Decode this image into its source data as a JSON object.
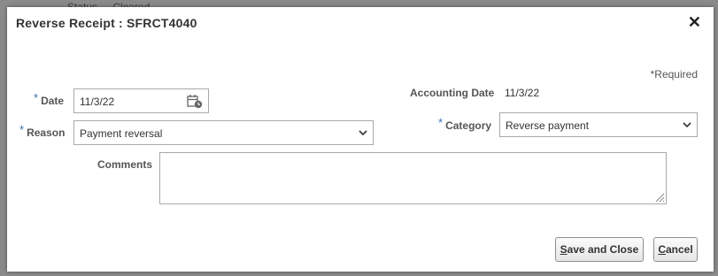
{
  "background": {
    "status_label": "Status",
    "status_value": "Cleared"
  },
  "dialog": {
    "title": "Reverse Receipt : SFRCT4040",
    "close_glyph": "✕",
    "required_note": "*Required"
  },
  "form": {
    "date": {
      "label": "Date",
      "required": "*",
      "value": "11/3/22",
      "icon": "calendar-icon"
    },
    "reason": {
      "label": "Reason",
      "required": "*",
      "value": "Payment reversal"
    },
    "comments": {
      "label": "Comments",
      "value": ""
    },
    "accounting_date": {
      "label": "Accounting Date",
      "value": "11/3/22"
    },
    "category": {
      "label": "Category",
      "required": "*",
      "value": "Reverse payment"
    }
  },
  "buttons": {
    "save_close": {
      "label": "Save and Close",
      "access_key": "S",
      "rest": "ave and Close"
    },
    "cancel": {
      "label": "Cancel",
      "access_key": "C",
      "rest": "ancel"
    }
  },
  "colors": {
    "required_star": "#3a6fb0",
    "dialog_bg": "#ffffff",
    "overlay": "#8a8a8a"
  }
}
